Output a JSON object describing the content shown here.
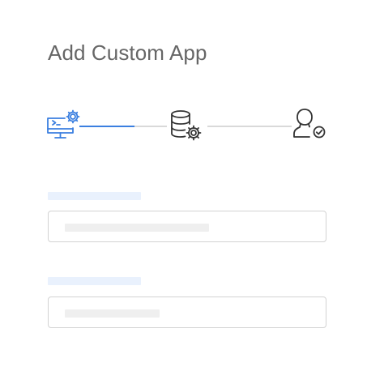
{
  "page": {
    "title": "Add Custom App"
  },
  "stepper": {
    "steps": [
      {
        "name": "configure-app",
        "icon": "monitor-gear-icon",
        "status": "active"
      },
      {
        "name": "database-settings",
        "icon": "database-gear-icon",
        "status": "pending"
      },
      {
        "name": "assign-users",
        "icon": "user-check-icon",
        "status": "pending"
      }
    ],
    "progress_fraction": 0.33,
    "colors": {
      "active": "#3b7fe0",
      "inactive": "#333333",
      "track": "#d9d9d9"
    }
  },
  "form": {
    "fields": [
      {
        "label": "",
        "value": "",
        "placeholder": ""
      },
      {
        "label": "",
        "value": "",
        "placeholder": ""
      }
    ]
  },
  "colors": {
    "label_skeleton": "#e9f1fd",
    "placeholder_skeleton": "#efefef",
    "field_border": "#d2d2d2",
    "title_text": "#666666"
  }
}
